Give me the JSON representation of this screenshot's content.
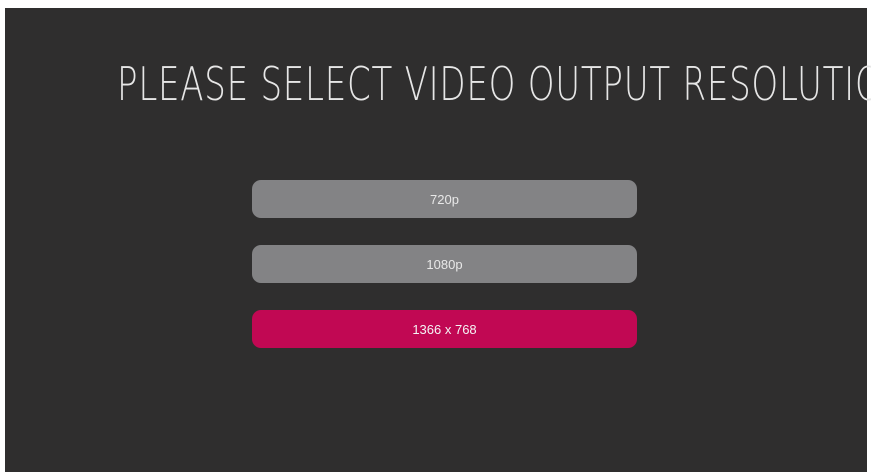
{
  "title": "PLEASE SELECT VIDEO OUTPUT RESOLUTION",
  "options": [
    {
      "label": "720p",
      "selected": false
    },
    {
      "label": "1080p",
      "selected": false
    },
    {
      "label": "1366 x 768",
      "selected": true
    }
  ],
  "colors": {
    "background": "#2f2e2e",
    "option": "#838385",
    "selected": "#c10853",
    "text": "#e6e6e6"
  }
}
